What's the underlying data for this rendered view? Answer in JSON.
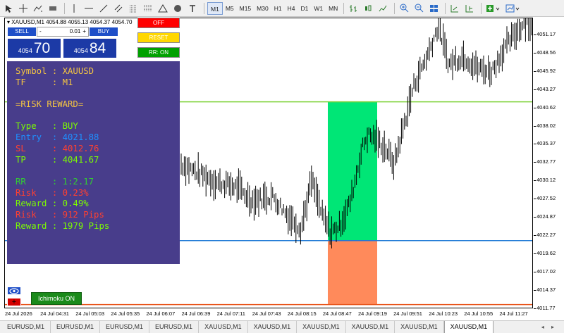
{
  "toolbar": {
    "timeframes": [
      "M1",
      "M5",
      "M15",
      "M30",
      "H1",
      "H4",
      "D1",
      "W1",
      "MN"
    ],
    "active_timeframe": "M1"
  },
  "chart": {
    "symbol_info": "XAUUSD,M1  4054.88 4055.13 4054.37 4054.70",
    "price_labels": [
      "4051.17",
      "4048.56",
      "4045.92",
      "4043.27",
      "4040.62",
      "4038.02",
      "4035.37",
      "4032.77",
      "4030.12",
      "4027.52",
      "4024.87",
      "4022.27",
      "4019.62",
      "4017.02",
      "4014.37",
      "4011.77"
    ],
    "time_labels": [
      "24 Jul 2026",
      "24 Jul 04:31",
      "24 Jul 05:03",
      "24 Jul 05:35",
      "24 Jul 06:07",
      "24 Jul 06:39",
      "24 Jul 07:11",
      "24 Jul 07:43",
      "24 Jul 08:15",
      "24 Jul 08:47",
      "24 Jul 09:19",
      "24 Jul 09:51",
      "24 Jul 10:23",
      "24 Jul 10:55",
      "24 Jul 11:27"
    ],
    "colors": {
      "tp_line": "#7fd23a",
      "entry_line": "#1e78d6",
      "sl_line": "#e8541a",
      "reward_zone": "#00e676",
      "risk_zone": "#ff8a5b"
    }
  },
  "trade_panel": {
    "sell_label": "SELL",
    "buy_label": "BUY",
    "lot_value": "0.01",
    "lot_minus": "-",
    "lot_plus": "+",
    "sell_price_small": "4054",
    "sell_price_big": "70",
    "buy_price_small": "4054",
    "buy_price_big": "84"
  },
  "controls": {
    "off_label": "OFF",
    "reset_label": "RESET",
    "rr_label": "RR: ON"
  },
  "risk_panel": {
    "lines": [
      {
        "text": "Symbol : XAUUSD",
        "color": "#f5c542"
      },
      {
        "text": "TF     : M1",
        "color": "#f5c542"
      },
      {
        "text": "",
        "color": "#ffffff"
      },
      {
        "text": "=RISK REWARD=",
        "color": "#f5c542"
      },
      {
        "text": "",
        "color": "#ffffff"
      },
      {
        "text": "Type   : BUY",
        "color": "#7cfc00"
      },
      {
        "text": "Entry  : 4021.88",
        "color": "#1e90ff"
      },
      {
        "text": "SL     : 4012.76",
        "color": "#ff4030"
      },
      {
        "text": "TP     : 4041.67",
        "color": "#7cfc00"
      },
      {
        "text": "",
        "color": "#ffffff"
      },
      {
        "text": "RR     : 1:2.17",
        "color": "#32cd32"
      },
      {
        "text": "Risk   : 0.23%",
        "color": "#ff4030"
      },
      {
        "text": "Reward : 0.49%",
        "color": "#7cfc00"
      },
      {
        "text": "Risk   : 912 Pips",
        "color": "#ff4030"
      },
      {
        "text": "Reward : 1979 Pips",
        "color": "#7cfc00"
      }
    ]
  },
  "buttons": {
    "ichimoku_label": "Ichimoku ON",
    "cross_label": "+"
  },
  "tabs": {
    "items": [
      "EURUSD,M1",
      "EURUSD,M1",
      "EURUSD,M1",
      "EURUSD,M1",
      "XAUUSD,M1",
      "XAUUSD,M1",
      "XAUUSD,M1",
      "XAUUSD,M1",
      "XAUUSD,M1",
      "XAUUSD,M1"
    ],
    "active_index": 9,
    "scroll_arrows": "◂ ▸"
  }
}
